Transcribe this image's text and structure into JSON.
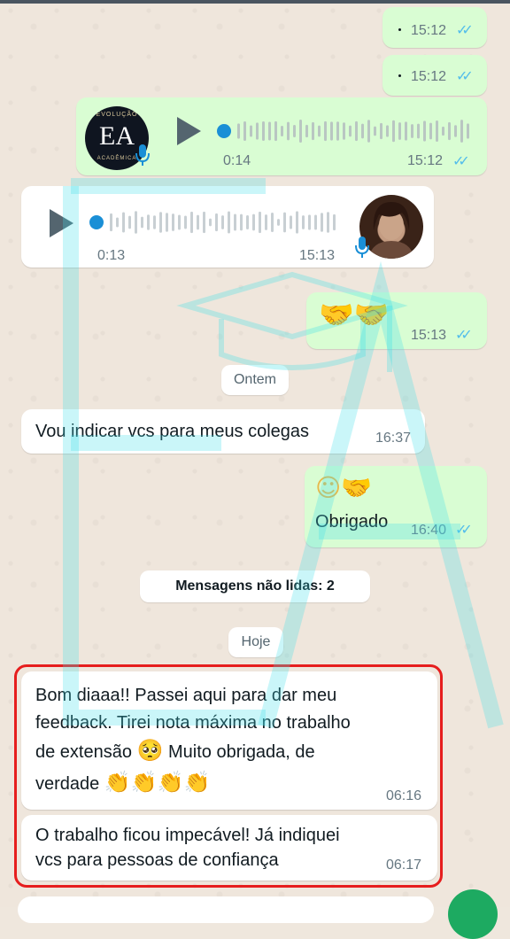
{
  "messages": {
    "dot1_time": "15:12",
    "dot2_time": "15:12",
    "audio_out": {
      "duration": "0:14",
      "time": "15:12",
      "logo_fa": "EA",
      "logo_top": "EVOLUÇÃO",
      "logo_bottom": "ACADÊMICA",
      "progress": 0
    },
    "audio_in": {
      "duration": "0:13",
      "time": "15:13",
      "progress": 0
    },
    "handshake": {
      "emoji": "🤝🤝",
      "time": "15:13"
    },
    "date_ontem": "Ontem",
    "indicar": {
      "text": "Vou indicar vcs para meus colegas",
      "time": "16:37"
    },
    "obrigado": {
      "emoji": "☺🤝",
      "text": "Obrigado",
      "time": "16:40"
    },
    "unread": "Mensagens não lidas: 2",
    "date_hoje": "Hoje",
    "feedback": {
      "line1": "Bom diaaa!! Passei aqui para dar meu",
      "line2": "feedback. Tirei nota máxima no trabalho",
      "line3a": "de extensão",
      "line3_emoji": "🥺",
      "line3b": "Muito obrigada, de",
      "line4a": "verdade",
      "line4_emoji": "👏👏👏👏",
      "time": "06:16"
    },
    "impecavel": {
      "line1": "O trabalho ficou impecável! Já indiquei",
      "line2": "vcs para pessoas de confiança",
      "time": "06:17"
    }
  },
  "colors": {
    "outgoing": "#d9fdd3",
    "incoming": "#ffffff",
    "read_ticks": "#53bdeb",
    "highlight": "#e61e1e",
    "watermark": "#3fe0e8"
  },
  "icons": [
    "double-check-icon",
    "play-icon",
    "mic-icon",
    "waveform-icon"
  ]
}
